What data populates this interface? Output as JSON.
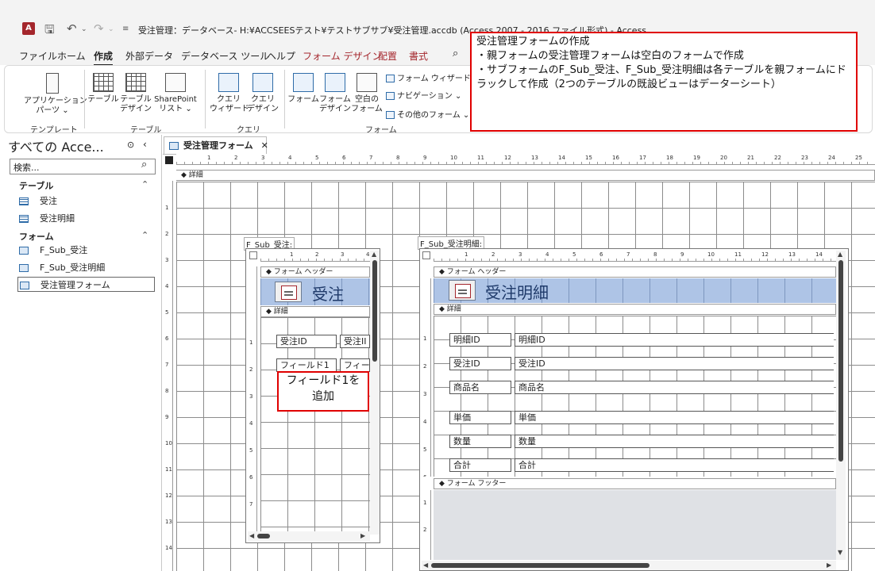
{
  "titlebar": {
    "app_icon_label": "A",
    "title": "受注管理：データベース- H:¥ACCSEESテスト¥テストサブサブ¥受注管理.accdb (Access 2007 - 2016 ファイル形式) - Access"
  },
  "menu": {
    "tabs": [
      {
        "label": "ファイル"
      },
      {
        "label": "ホーム"
      },
      {
        "label": "作成"
      },
      {
        "label": "外部データ"
      },
      {
        "label": "データベース ツール"
      },
      {
        "label": "ヘルプ"
      },
      {
        "label": "フォーム デザイン"
      },
      {
        "label": "配置"
      },
      {
        "label": "書式"
      }
    ]
  },
  "ribbon": {
    "buttons": [
      {
        "line1": "アプリケーション",
        "line2": "パーツ ⌄"
      },
      {
        "line1": "テーブル",
        "line2": ""
      },
      {
        "line1": "テーブル",
        "line2": "デザイン"
      },
      {
        "line1": "SharePoint",
        "line2": "リスト ⌄"
      },
      {
        "line1": "クエリ",
        "line2": "ウィザード"
      },
      {
        "line1": "クエリ",
        "line2": "デザイン"
      },
      {
        "line1": "フォーム",
        "line2": ""
      },
      {
        "line1": "フォーム",
        "line2": "デザイン"
      },
      {
        "line1": "空白の",
        "line2": "フォーム"
      }
    ],
    "small_buttons": [
      {
        "label": "フォーム ウィザード"
      },
      {
        "label": "ナビゲーション ⌄"
      },
      {
        "label": "その他のフォーム ⌄"
      }
    ],
    "groups": [
      "テンプレート",
      "テーブル",
      "クエリ",
      "フォーム"
    ]
  },
  "nav": {
    "title": "すべての Acce...",
    "search_placeholder": "検索...",
    "sections": [
      {
        "label": "テーブル",
        "items": [
          "受注",
          "受注明細"
        ]
      },
      {
        "label": "フォーム",
        "items": [
          "F_Sub_受注",
          "F_Sub_受注明細",
          "受注管理フォーム"
        ]
      }
    ]
  },
  "document": {
    "tab_label": "受注管理フォーム",
    "detail_section": "詳細",
    "main_ruler_numbers": [
      "1",
      "2",
      "3",
      "4",
      "5",
      "6",
      "7",
      "8",
      "9",
      "10",
      "11",
      "12",
      "13",
      "14",
      "15",
      "16",
      "17",
      "18",
      "19",
      "20",
      "21",
      "22",
      "23",
      "24",
      "25"
    ],
    "main_vruler_numbers": [
      "1",
      "2",
      "3",
      "4",
      "5",
      "6",
      "7",
      "8",
      "9",
      "10",
      "11",
      "12",
      "13",
      "14"
    ]
  },
  "subform_order": {
    "label": "F_Sub_受注:",
    "header_section": "フォーム ヘッダー",
    "detail_section": "詳細",
    "title": "受注",
    "ruler_numbers": [
      "1",
      "2",
      "3",
      "4"
    ],
    "vruler_numbers": [
      "1",
      "2",
      "3",
      "4",
      "5",
      "6",
      "7"
    ],
    "controls": {
      "label_id": "受注ID",
      "text_id": "受注II",
      "label_field1": "フィールド1",
      "text_field1": "フィー"
    }
  },
  "subform_detail": {
    "label": "F_Sub_受注明細:",
    "header_section": "フォーム ヘッダー",
    "detail_section": "詳細",
    "footer_section": "フォーム フッター",
    "title": "受注明細",
    "ruler_numbers": [
      "1",
      "2",
      "3",
      "4",
      "5",
      "6",
      "7",
      "8",
      "9",
      "10",
      "11",
      "12",
      "13",
      "14"
    ],
    "vruler_numbers": [
      "1",
      "2",
      "3",
      "4",
      "5",
      "6"
    ],
    "footer_vruler_numbers": [
      "1",
      "2"
    ],
    "rows": [
      {
        "label": "明細ID",
        "value": "明細ID"
      },
      {
        "label": "受注ID",
        "value": "受注ID"
      },
      {
        "label": "商品名",
        "value": "商品名"
      },
      {
        "label": "単価",
        "value": "単価"
      },
      {
        "label": "数量",
        "value": "数量"
      },
      {
        "label": "合計",
        "value": "合計"
      }
    ]
  },
  "callouts": {
    "main": {
      "line1": "受注管理フォームの作成",
      "line2": "・親フォームの受注管理フォームは空白のフォームで作成",
      "line3": "・サブフォームのF_Sub_受注、F_Sub_受注明細は各テーブルを親フォームにドラックして作成（2つのテーブルの既設ビューはデーターシート）"
    },
    "field": {
      "line1": "フィールド1を",
      "line2": "追加"
    }
  },
  "colors": {
    "accent": "#a4262c",
    "callout_border": "#e00000",
    "header_band": "#aec4e6"
  }
}
